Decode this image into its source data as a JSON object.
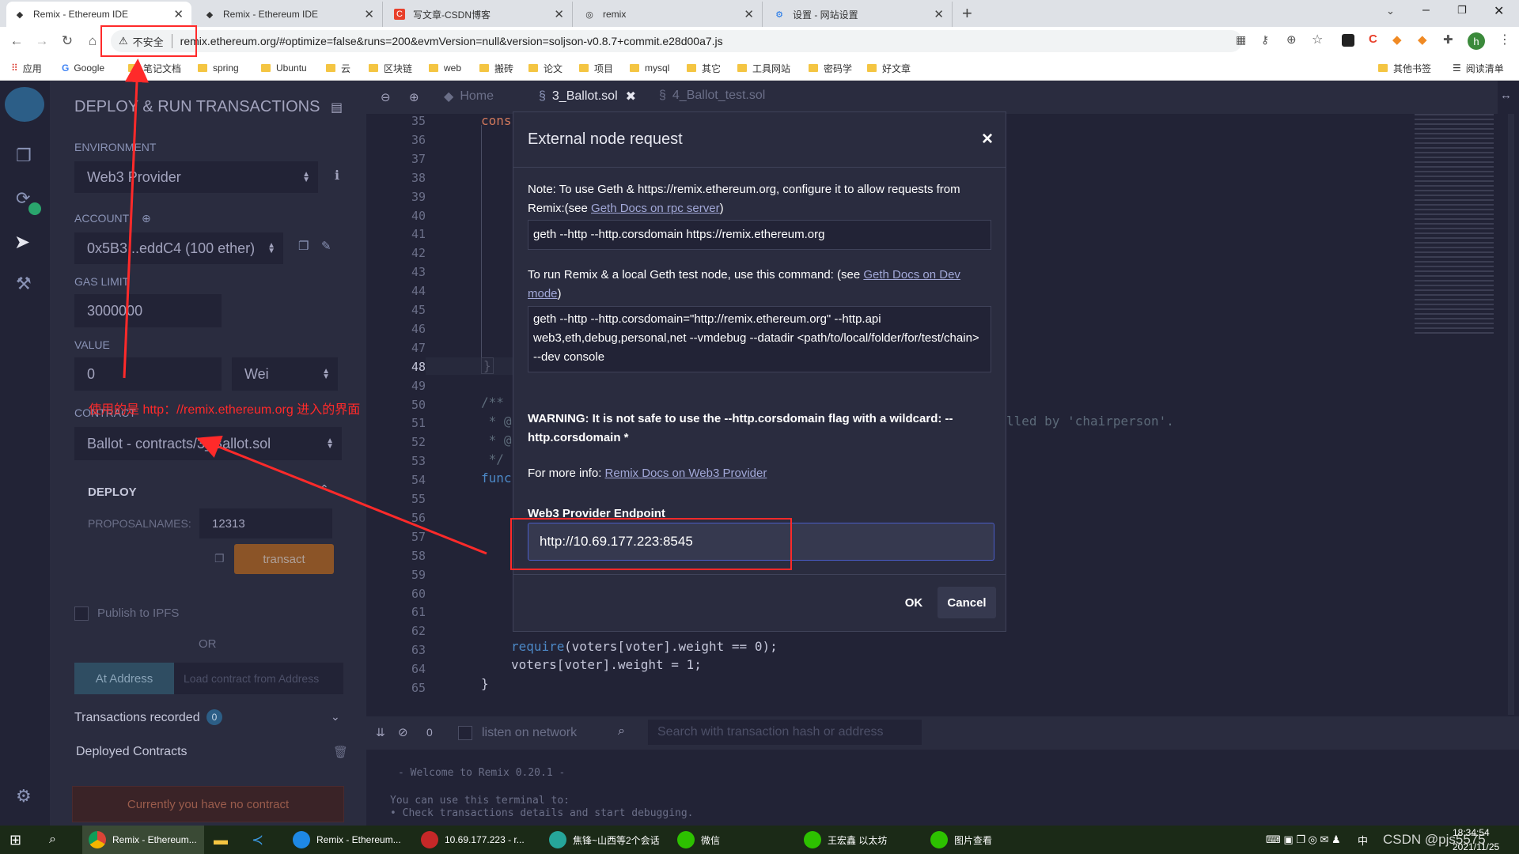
{
  "browser": {
    "tabs": [
      {
        "title": "Remix - Ethereum IDE",
        "active": true
      },
      {
        "title": "Remix - Ethereum IDE",
        "active": false
      },
      {
        "title": "写文章-CSDN博客",
        "active": false
      },
      {
        "title": "remix",
        "active": false
      },
      {
        "title": "设置 - 网站设置",
        "active": false
      }
    ],
    "new_tab": "+",
    "security_label": "不安全",
    "url": "remix.ethereum.org/#optimize=false&runs=200&evmVersion=null&version=soljson-v0.8.7+commit.e28d00a7.js",
    "profile_initial": "h",
    "bookmarks": [
      "应用",
      "Google",
      "笔记文档",
      "spring",
      "Ubuntu",
      "云",
      "区块链",
      "web",
      "搬砖",
      "论文",
      "项目",
      "mysql",
      "其它",
      "工具网站",
      "密码学",
      "好文章"
    ],
    "other_bookmarks": "其他书签",
    "reading_list": "阅读清单"
  },
  "remix": {
    "panel_title": "DEPLOY & RUN TRANSACTIONS",
    "environment_label": "ENVIRONMENT",
    "environment_value": "Web3 Provider",
    "account_label": "ACCOUNT",
    "account_value": "0x5B3...eddC4 (100 ether)",
    "gas_limit_label": "GAS LIMIT",
    "gas_limit_value": "3000000",
    "value_label": "VALUE",
    "value_amount": "0",
    "value_unit": "Wei",
    "contract_label": "CONTRACT",
    "contract_value": "Ballot - contracts/3_Ballot.sol",
    "deploy_label": "DEPLOY",
    "proposal_label": "PROPOSALNAMES:",
    "proposal_value": "12313",
    "transact_label": "transact",
    "publish_label": "Publish to IPFS",
    "or_label": "OR",
    "at_address_label": "At Address",
    "load_contract_placeholder": "Load contract from Address",
    "transactions_recorded_label": "Transactions recorded",
    "transactions_count": "0",
    "deployed_contracts_label": "Deployed Contracts",
    "no_contract_text": "Currently you have no contract",
    "editor_tabs": [
      "Home",
      "3_Ballot.sol",
      "4_Ballot_test.sol"
    ],
    "line_numbers": [
      "35",
      "36",
      "37",
      "38",
      "39",
      "40",
      "41",
      "42",
      "43",
      "44",
      "45",
      "46",
      "47",
      "48",
      "49",
      "50",
      "51",
      "52",
      "53",
      "54",
      "55",
      "56",
      "57",
      "58",
      "59",
      "60",
      "61",
      "62",
      "63",
      "64",
      "65"
    ],
    "code_fragments": {
      "l35": "cons",
      "l48": "}",
      "l50": "/**",
      "l51a": " * @",
      "l51b": "lled by 'chairperson'.",
      "l52": " * @",
      "l53": " */",
      "l54": "func",
      "l63a": "require",
      "l63b": "(voters[voter].weight == 0);",
      "l64": "voters[voter].weight = 1;",
      "l65": "}"
    },
    "terminal_count": "0",
    "listen_label": "listen on network",
    "terminal_search_placeholder": "Search with transaction hash or address",
    "terminal_welcome": "- Welcome to Remix 0.20.1 -",
    "terminal_line1": "You can use this terminal to:",
    "terminal_line2": "• Check transactions details and start debugging."
  },
  "modal": {
    "title": "External node request",
    "close": "×",
    "note_text": "Note: To use Geth & https://remix.ethereum.org, configure it to allow requests from Remix:(see ",
    "note_link": "Geth Docs on rpc server",
    "note_end": ")",
    "cmd1": "geth --http --http.corsdomain https://remix.ethereum.org",
    "run_text": "To run Remix & a local Geth test node, use this command: (see ",
    "run_link": "Geth Docs on Dev mode",
    "run_end": ")",
    "cmd2": "geth --http --http.corsdomain=\"http://remix.ethereum.org\" --http.api web3,eth,debug,personal,net --vmdebug --datadir <path/to/local/folder/for/test/chain> --dev console",
    "warning": "WARNING: It is not safe to use the --http.corsdomain flag with a wildcard: --http.corsdomain *",
    "more_info": "For more info: ",
    "more_info_link": "Remix Docs on Web3 Provider",
    "endpoint_label": "Web3 Provider Endpoint",
    "endpoint_value": "http://10.69.177.223:8545",
    "ok_label": "OK",
    "cancel_label": "Cancel"
  },
  "annotation": {
    "text": "使用的是 http：//remix.ethereum.org 进入的界面",
    "color": "#ff2a2a"
  },
  "taskbar": {
    "items": [
      "Remix - Ethereum...",
      "Remix - Ethereum...",
      "10.69.177.223 - r...",
      "焦锋~山西等2个会话",
      "微信",
      "王宏鑫 以太坊",
      "图片查看"
    ],
    "ime_label": "中",
    "time": "18:34:54",
    "date": "2021/11/25",
    "watermark": "CSDN @pjs5575"
  }
}
